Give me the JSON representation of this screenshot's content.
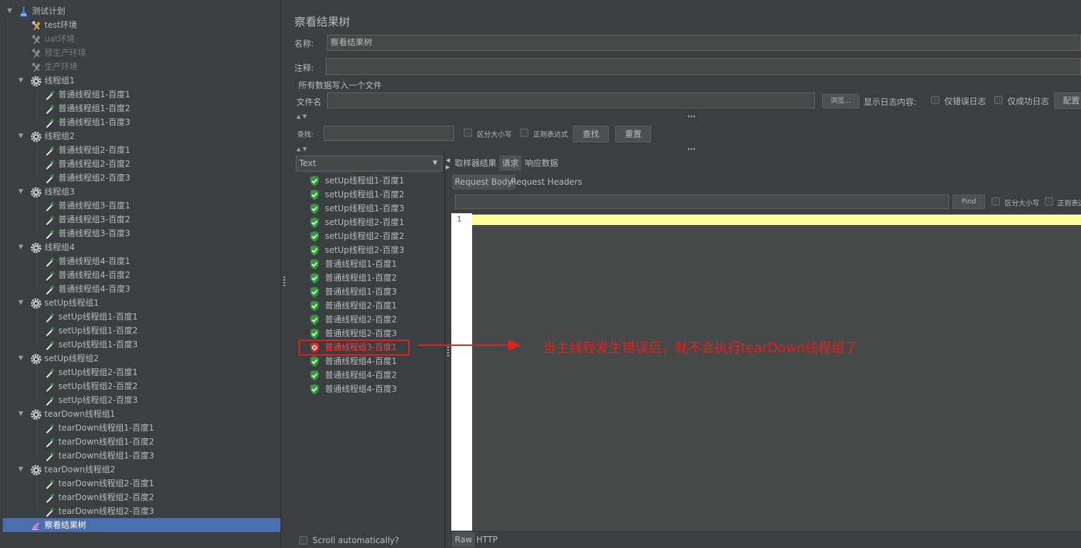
{
  "tree": {
    "root": "测试计划",
    "env_items": [
      {
        "label": "test环境",
        "disabled": false
      },
      {
        "label": "uat环境",
        "disabled": true
      },
      {
        "label": "预生产环境",
        "disabled": true
      },
      {
        "label": "生产环境",
        "disabled": true
      }
    ],
    "groups": [
      {
        "label": "线程组1",
        "children": [
          "普通线程组1-百度1",
          "普通线程组1-百度2",
          "普通线程组1-百度3"
        ]
      },
      {
        "label": "线程组2",
        "children": [
          "普通线程组2-百度1",
          "普通线程组2-百度2",
          "普通线程组2-百度3"
        ]
      },
      {
        "label": "线程组3",
        "children": [
          "普通线程组3-百度1",
          "普通线程组3-百度2",
          "普通线程组3-百度3"
        ]
      },
      {
        "label": "线程组4",
        "children": [
          "普通线程组4-百度1",
          "普通线程组4-百度2",
          "普通线程组4-百度3"
        ]
      },
      {
        "label": "setUp线程组1",
        "children": [
          "setUp线程组1-百度1",
          "setUp线程组1-百度2",
          "setUp线程组1-百度3"
        ]
      },
      {
        "label": "setUp线程组2",
        "children": [
          "setUp线程组2-百度1",
          "setUp线程组2-百度2",
          "setUp线程组2-百度3"
        ]
      },
      {
        "label": "tearDown线程组1",
        "children": [
          "tearDown线程组1-百度1",
          "tearDown线程组1-百度2",
          "tearDown线程组1-百度3"
        ]
      },
      {
        "label": "tearDown线程组2",
        "children": [
          "tearDown线程组2-百度1",
          "tearDown线程组2-百度2",
          "tearDown线程组2-百度3"
        ]
      }
    ],
    "selected_item": "察看结果树"
  },
  "panel": {
    "title": "察看结果树",
    "name_label": "名称:",
    "name_value": "察看结果树",
    "comment_label": "注释:",
    "comment_value": "",
    "file_section_label": "所有数据写入一个文件",
    "filename_label": "文件名",
    "filename_value": "",
    "browse_button": "浏览...",
    "log_content_label": "显示日志内容:",
    "errors_only_label": "仅错误日志",
    "success_only_label": "仅成功日志",
    "config_button": "配置",
    "search_label": "查找:",
    "search_value": "",
    "case_sensitive_label": "区分大小写",
    "regex_label": "正则表达式",
    "find_button": "查找",
    "reset_button": "重置",
    "renderer_select": "Text",
    "results": [
      {
        "label": "setUp线程组1-百度1",
        "status": "success"
      },
      {
        "label": "setUp线程组1-百度2",
        "status": "success"
      },
      {
        "label": "setUp线程组1-百度3",
        "status": "success"
      },
      {
        "label": "setUp线程组2-百度1",
        "status": "success"
      },
      {
        "label": "setUp线程组2-百度2",
        "status": "success"
      },
      {
        "label": "setUp线程组2-百度3",
        "status": "success"
      },
      {
        "label": "普通线程组1-百度1",
        "status": "success"
      },
      {
        "label": "普通线程组1-百度2",
        "status": "success"
      },
      {
        "label": "普通线程组1-百度3",
        "status": "success"
      },
      {
        "label": "普通线程组2-百度1",
        "status": "success"
      },
      {
        "label": "普通线程组2-百度2",
        "status": "success"
      },
      {
        "label": "普通线程组2-百度3",
        "status": "success"
      },
      {
        "label": "普通线程组3-百度1",
        "status": "error"
      },
      {
        "label": "普通线程组4-百度1",
        "status": "success"
      },
      {
        "label": "普通线程组4-百度2",
        "status": "success"
      },
      {
        "label": "普通线程组4-百度3",
        "status": "success"
      }
    ],
    "scroll_auto_label": "Scroll automatically?",
    "tabs": [
      "取样器结果",
      "请求",
      "响应数据"
    ],
    "active_tab": "请求",
    "subtabs": [
      "Request Body",
      "Request Headers"
    ],
    "active_subtab": "Request Body",
    "find_input_value": "",
    "find_small_button": "Find",
    "sub_case_label": "区分大小写",
    "sub_regex_label": "正则表达",
    "line_number": "1",
    "bottom_tabs": [
      "Raw",
      "HTTP"
    ],
    "active_bottom_tab": "Raw"
  },
  "annotation": {
    "text": "当主线程发生错误后，就不会执行tearDown线程组了",
    "color": "#e5211d"
  },
  "colors": {
    "success": "#2f9e3a",
    "error": "#d9302c",
    "selection": "#4b6eaf"
  }
}
